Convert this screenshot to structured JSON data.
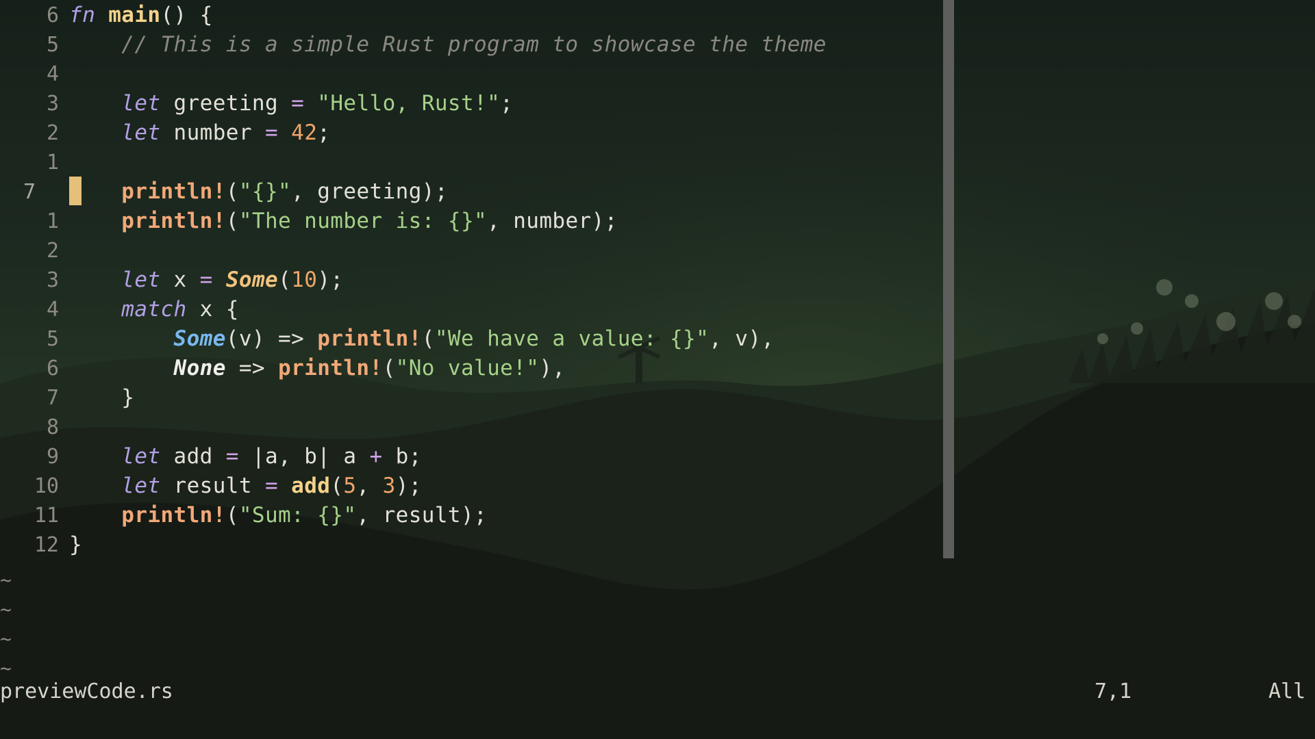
{
  "editor": {
    "lines": [
      {
        "num": "6",
        "current": false,
        "tokens": [
          {
            "t": "kw",
            "v": "fn"
          },
          {
            "t": "plain",
            "v": " "
          },
          {
            "t": "fnname",
            "v": "main"
          },
          {
            "t": "plain",
            "v": "() {"
          }
        ]
      },
      {
        "num": "5",
        "current": false,
        "tokens": [
          {
            "t": "plain",
            "v": "    "
          },
          {
            "t": "cmt",
            "v": "// This is a simple Rust program to showcase the theme"
          }
        ]
      },
      {
        "num": "4",
        "current": false,
        "tokens": []
      },
      {
        "num": "3",
        "current": false,
        "tokens": [
          {
            "t": "plain",
            "v": "    "
          },
          {
            "t": "kw",
            "v": "let"
          },
          {
            "t": "plain",
            "v": " greeting "
          },
          {
            "t": "op",
            "v": "="
          },
          {
            "t": "plain",
            "v": " "
          },
          {
            "t": "str",
            "v": "\"Hello, Rust!\""
          },
          {
            "t": "plain",
            "v": ";"
          }
        ]
      },
      {
        "num": "2",
        "current": false,
        "tokens": [
          {
            "t": "plain",
            "v": "    "
          },
          {
            "t": "kw",
            "v": "let"
          },
          {
            "t": "plain",
            "v": " number "
          },
          {
            "t": "op",
            "v": "="
          },
          {
            "t": "plain",
            "v": " "
          },
          {
            "t": "numlit",
            "v": "42"
          },
          {
            "t": "plain",
            "v": ";"
          }
        ]
      },
      {
        "num": "1",
        "current": false,
        "tokens": []
      },
      {
        "num": "7",
        "current": true,
        "tokens": [
          {
            "t": "plain",
            "v": "    "
          },
          {
            "t": "mac",
            "v": "println!"
          },
          {
            "t": "plain",
            "v": "("
          },
          {
            "t": "str",
            "v": "\"{}\""
          },
          {
            "t": "plain",
            "v": ", greeting);"
          }
        ]
      },
      {
        "num": "1",
        "current": false,
        "tokens": [
          {
            "t": "plain",
            "v": "    "
          },
          {
            "t": "mac",
            "v": "println!"
          },
          {
            "t": "plain",
            "v": "("
          },
          {
            "t": "str",
            "v": "\"The number is: {}\""
          },
          {
            "t": "plain",
            "v": ", number);"
          }
        ]
      },
      {
        "num": "2",
        "current": false,
        "tokens": []
      },
      {
        "num": "3",
        "current": false,
        "tokens": [
          {
            "t": "plain",
            "v": "    "
          },
          {
            "t": "kw",
            "v": "let"
          },
          {
            "t": "plain",
            "v": " x "
          },
          {
            "t": "op",
            "v": "="
          },
          {
            "t": "plain",
            "v": " "
          },
          {
            "t": "some1",
            "v": "Some"
          },
          {
            "t": "plain",
            "v": "("
          },
          {
            "t": "numlit",
            "v": "10"
          },
          {
            "t": "plain",
            "v": ");"
          }
        ]
      },
      {
        "num": "4",
        "current": false,
        "tokens": [
          {
            "t": "plain",
            "v": "    "
          },
          {
            "t": "kw",
            "v": "match"
          },
          {
            "t": "plain",
            "v": " x {"
          }
        ]
      },
      {
        "num": "5",
        "current": false,
        "tokens": [
          {
            "t": "plain",
            "v": "        "
          },
          {
            "t": "some2",
            "v": "Some"
          },
          {
            "t": "plain",
            "v": "(v) => "
          },
          {
            "t": "mac",
            "v": "println!"
          },
          {
            "t": "plain",
            "v": "("
          },
          {
            "t": "str",
            "v": "\"We have a value: {}\""
          },
          {
            "t": "plain",
            "v": ", v),"
          }
        ]
      },
      {
        "num": "6",
        "current": false,
        "tokens": [
          {
            "t": "plain",
            "v": "        "
          },
          {
            "t": "none",
            "v": "None"
          },
          {
            "t": "plain",
            "v": " => "
          },
          {
            "t": "mac",
            "v": "println!"
          },
          {
            "t": "plain",
            "v": "("
          },
          {
            "t": "str",
            "v": "\"No value!\""
          },
          {
            "t": "plain",
            "v": "),"
          }
        ]
      },
      {
        "num": "7",
        "current": false,
        "tokens": [
          {
            "t": "plain",
            "v": "    }"
          }
        ]
      },
      {
        "num": "8",
        "current": false,
        "tokens": []
      },
      {
        "num": "9",
        "current": false,
        "tokens": [
          {
            "t": "plain",
            "v": "    "
          },
          {
            "t": "kw",
            "v": "let"
          },
          {
            "t": "plain",
            "v": " add "
          },
          {
            "t": "op",
            "v": "="
          },
          {
            "t": "plain",
            "v": " |a, b| a "
          },
          {
            "t": "op",
            "v": "+"
          },
          {
            "t": "plain",
            "v": " b;"
          }
        ]
      },
      {
        "num": "10",
        "current": false,
        "tokens": [
          {
            "t": "plain",
            "v": "    "
          },
          {
            "t": "kw",
            "v": "let"
          },
          {
            "t": "plain",
            "v": " result "
          },
          {
            "t": "op",
            "v": "="
          },
          {
            "t": "plain",
            "v": " "
          },
          {
            "t": "fnname",
            "v": "add"
          },
          {
            "t": "plain",
            "v": "("
          },
          {
            "t": "numlit",
            "v": "5"
          },
          {
            "t": "plain",
            "v": ", "
          },
          {
            "t": "numlit",
            "v": "3"
          },
          {
            "t": "plain",
            "v": ");"
          }
        ]
      },
      {
        "num": "11",
        "current": false,
        "tokens": [
          {
            "t": "plain",
            "v": "    "
          },
          {
            "t": "mac",
            "v": "println!"
          },
          {
            "t": "plain",
            "v": "("
          },
          {
            "t": "str",
            "v": "\"Sum: {}\""
          },
          {
            "t": "plain",
            "v": ", result);"
          }
        ]
      },
      {
        "num": "12",
        "current": false,
        "tokens": [
          {
            "t": "plain",
            "v": "}"
          }
        ]
      }
    ],
    "empty_line_markers": [
      "~",
      "~",
      "~",
      "~"
    ]
  },
  "statusbar": {
    "filename": "previewCode.rs",
    "cursor_position": "7,1",
    "scroll_position": "All"
  },
  "colors": {
    "keyword": "#b3a0e6",
    "macro": "#f2a878",
    "string": "#a6d189",
    "number": "#f0a56a",
    "comment": "#8a8880",
    "cursor": "#e5c07b",
    "scrollbar": "#5e5f5c"
  }
}
